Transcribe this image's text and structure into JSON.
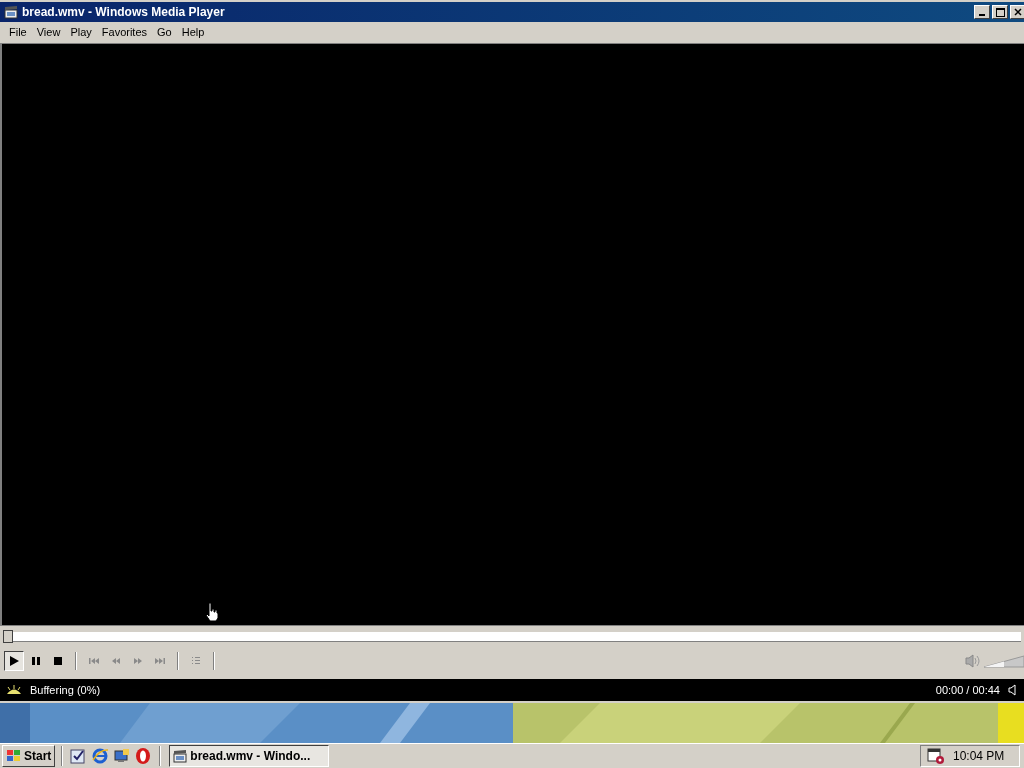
{
  "window": {
    "title": "bread.wmv - Windows Media Player"
  },
  "menu": [
    {
      "label": "File"
    },
    {
      "label": "View"
    },
    {
      "label": "Play"
    },
    {
      "label": "Favorites"
    },
    {
      "label": "Go"
    },
    {
      "label": "Help"
    }
  ],
  "seek": {
    "level": 0
  },
  "volume": {
    "level": 0.5
  },
  "controls": [
    {
      "kind": "play",
      "disabled": false
    },
    {
      "kind": "pause",
      "disabled": false
    },
    {
      "kind": "stop",
      "disabled": false
    },
    {
      "kind": "prev",
      "disabled": true
    },
    {
      "kind": "rewind",
      "disabled": true
    },
    {
      "kind": "forward",
      "disabled": true
    },
    {
      "kind": "next",
      "disabled": true
    },
    {
      "kind": "playlist",
      "disabled": true
    }
  ],
  "status": {
    "text": "Buffering (0%)",
    "time": "00:00 / 00:44"
  },
  "taskbar": {
    "start": "Start",
    "task": "bread.wmv - Windo...",
    "clock": "10:04 PM"
  }
}
